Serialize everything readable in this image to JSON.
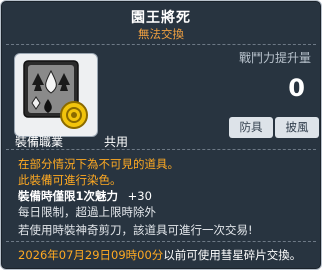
{
  "item": {
    "name": "園王將死",
    "trade_status": "無法交換"
  },
  "combat_power": {
    "label": "戰鬥力提升量",
    "value": "0"
  },
  "stat_buttons": {
    "defense": "防具",
    "remove": "披風"
  },
  "equip_requirement": {
    "label": "裝備職業",
    "value": "共用"
  },
  "description": {
    "line1": "在部分情況下為不可見的道具。",
    "line2": "此裝備可進行染色。",
    "line3_label": "裝備時僅限1次魅力",
    "line3_value": "+30",
    "line4": "每日限制，超過上限時除外",
    "line5": "若使用時裝神奇剪刀，該道具可進行一次交易!"
  },
  "footer": {
    "date": "2026年07月29日09時00分",
    "text": "以前可使用彗星碎片交換。"
  },
  "colors": {
    "background": "#283440",
    "accent_orange": "#ffaa22",
    "trade_status": "#f0a040"
  }
}
